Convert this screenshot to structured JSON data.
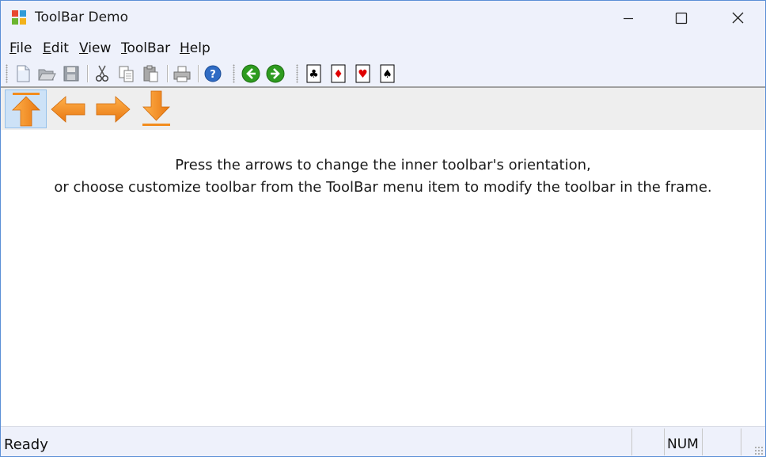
{
  "window": {
    "title": "ToolBar Demo"
  },
  "menu": [
    {
      "mnemonic": "F",
      "rest": "ile"
    },
    {
      "mnemonic": "E",
      "rest": "dit"
    },
    {
      "mnemonic": "V",
      "rest": "iew"
    },
    {
      "mnemonic": "T",
      "rest": "oolBar"
    },
    {
      "mnemonic": "H",
      "rest": "elp"
    }
  ],
  "toolbar_icons": [
    "new-file-icon",
    "open-folder-icon",
    "save-icon",
    "cut-icon",
    "copy-icon",
    "paste-icon",
    "print-icon",
    "help-icon",
    "back-icon",
    "forward-icon",
    "card-clubs-icon",
    "card-diamonds-icon",
    "card-hearts-icon",
    "card-spades-icon"
  ],
  "inner_toolbar": {
    "icons": [
      "arrow-up-icon",
      "arrow-left-icon",
      "arrow-right-icon",
      "arrow-down-icon"
    ],
    "active": "arrow-up-icon"
  },
  "message": {
    "line1": "Press the arrows to change the inner toolbar's orientation,",
    "line2": "or choose customize toolbar from the ToolBar menu item to modify the toolbar in the frame."
  },
  "status": {
    "text": "Ready",
    "num": "NUM"
  },
  "colors": {
    "titlebar": "#eef1fb",
    "arrow": "#f28c1e",
    "nav_green": "#2e9b1f",
    "help_blue": "#2f6bc4",
    "card_red": "#e00000"
  }
}
